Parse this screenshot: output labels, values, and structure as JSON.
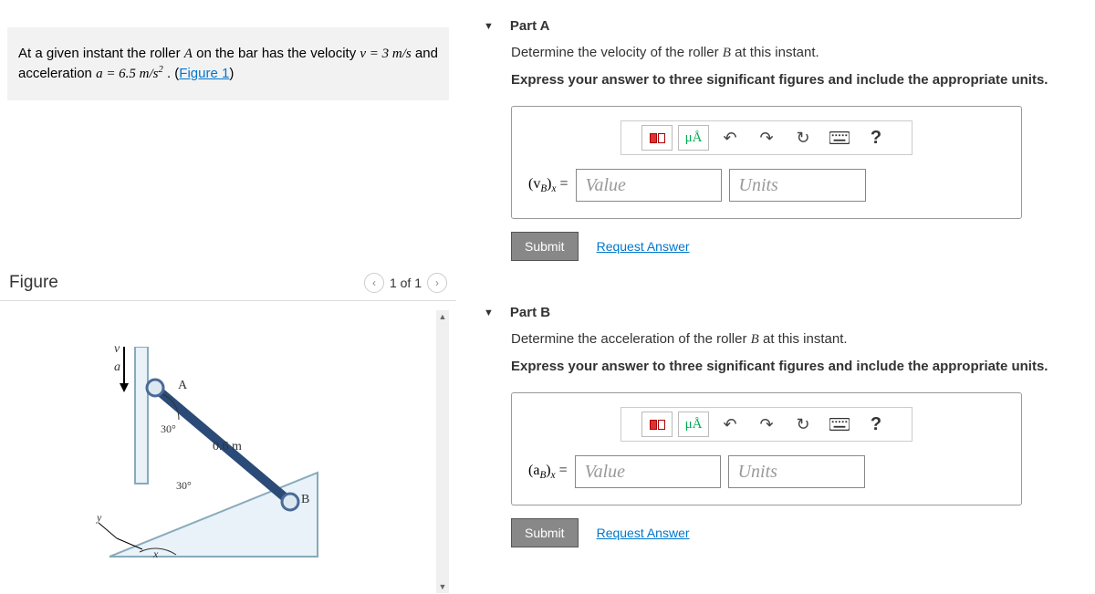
{
  "problem": {
    "text_pre": "At a given instant the roller ",
    "roller_a": "A",
    "text_mid1": " on the bar has the velocity ",
    "v_eq": "v = 3  m/s",
    "text_mid2": " and acceleration ",
    "a_eq": "a = 6.5  m/s",
    "a_exp": "2",
    "text_end": " . (",
    "figure_link": "Figure 1",
    "paren": ")"
  },
  "figure": {
    "title": "Figure",
    "counter": "1 of 1",
    "labels": {
      "v": "v",
      "a": "a",
      "A": "A",
      "B": "B",
      "len": "0.6 m",
      "ang1": "30°",
      "ang2": "30°",
      "x": "x",
      "y": "y"
    }
  },
  "parts": [
    {
      "title": "Part A",
      "prompt_pre": "Determine the velocity of the roller ",
      "prompt_var": "B",
      "prompt_post": " at this instant.",
      "instruction": "Express your answer to three significant figures and include the appropriate units.",
      "var_label_pre": "(v",
      "var_label_sub": "B",
      "var_label_post": ")",
      "var_label_sub2": "x",
      "eq": " = ",
      "value_ph": "Value",
      "units_ph": "Units",
      "submit": "Submit",
      "request": "Request Answer"
    },
    {
      "title": "Part B",
      "prompt_pre": "Determine the acceleration of the roller ",
      "prompt_var": "B",
      "prompt_post": " at this instant.",
      "instruction": "Express your answer to three significant figures and include the appropriate units.",
      "var_label_pre": "(a",
      "var_label_sub": "B",
      "var_label_post": ")",
      "var_label_sub2": "x",
      "eq": " = ",
      "value_ph": "Value",
      "units_ph": "Units",
      "submit": "Submit",
      "request": "Request Answer"
    }
  ],
  "toolbar": {
    "units_symbol": "μÅ",
    "help": "?"
  }
}
